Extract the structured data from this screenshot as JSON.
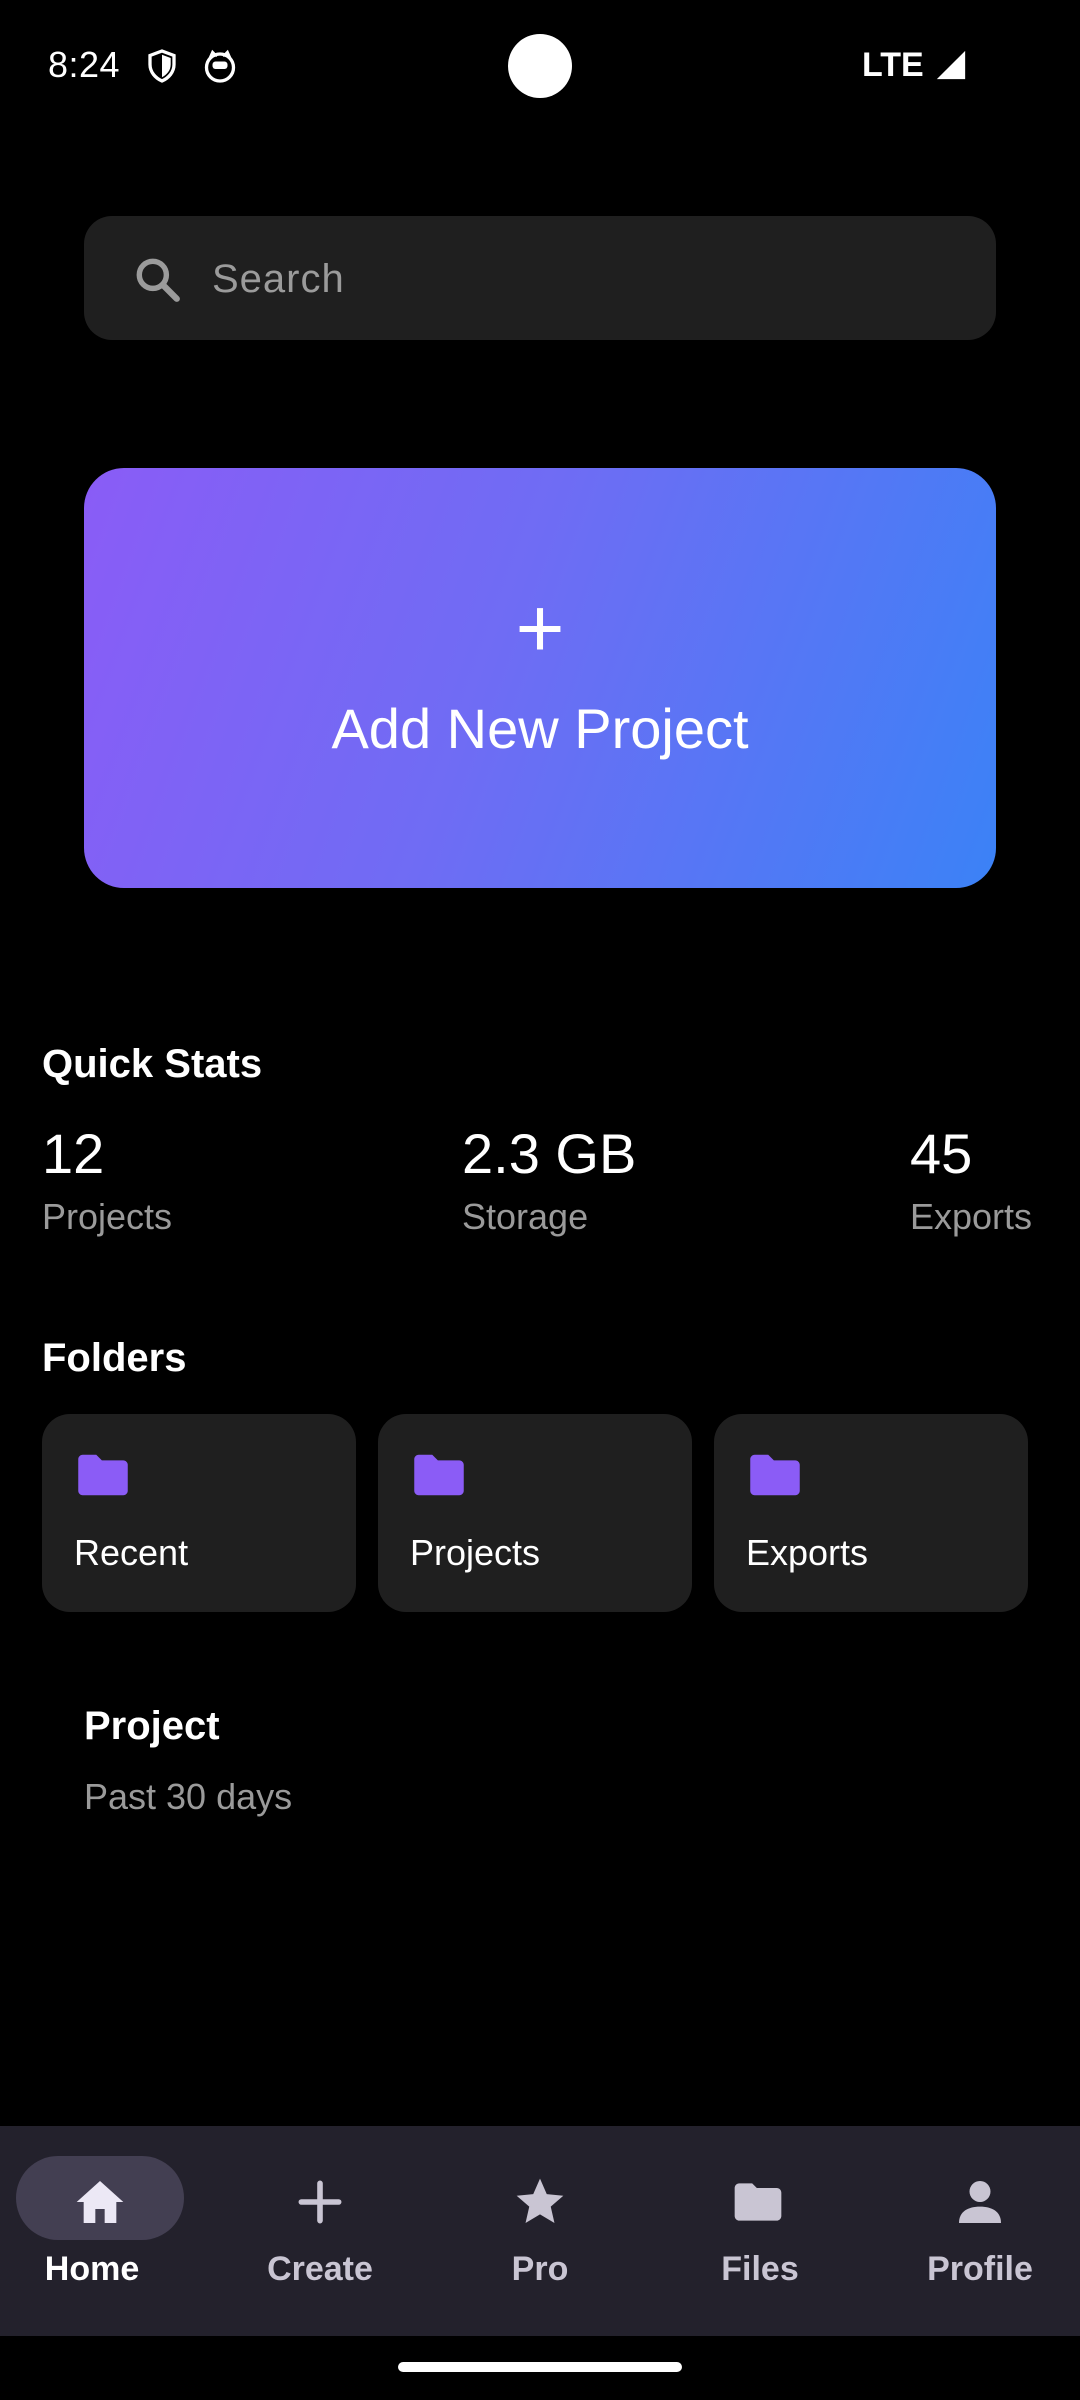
{
  "status_bar": {
    "time": "8:24",
    "network": "LTE",
    "icons": [
      "shield-icon",
      "cat-face-icon",
      "signal-icon"
    ]
  },
  "search": {
    "placeholder": "Search",
    "value": ""
  },
  "add_project": {
    "plus": "+",
    "label": "Add New Project",
    "gradient_colors": [
      "#8a5cf6",
      "#3b82f6"
    ]
  },
  "quick_stats": {
    "title": "Quick Stats",
    "items": [
      {
        "value": "12",
        "label": "Projects"
      },
      {
        "value": "2.3 GB",
        "label": "Storage"
      },
      {
        "value": "45",
        "label": "Exports"
      }
    ]
  },
  "folders": {
    "title": "Folders",
    "items": [
      {
        "label": "Recent",
        "icon": "folder-icon"
      },
      {
        "label": "Projects",
        "icon": "folder-icon"
      },
      {
        "label": "Exports",
        "icon": "folder-icon"
      }
    ],
    "accent": "#8b5cf6"
  },
  "project": {
    "title": "Project",
    "subtitle": "Past 30 days"
  },
  "bottom_nav": {
    "active": "Home",
    "items": [
      {
        "label": "Home",
        "icon": "home-icon"
      },
      {
        "label": "Create",
        "icon": "plus-icon"
      },
      {
        "label": "Pro",
        "icon": "star-icon"
      },
      {
        "label": "Files",
        "icon": "folder-icon"
      },
      {
        "label": "Profile",
        "icon": "person-icon"
      }
    ]
  },
  "colors": {
    "background": "#000000",
    "surface": "#1f1f1f",
    "nav_background": "#23212c",
    "nav_active_pill": "#433f52",
    "secondary_text": "#9a9a9a"
  }
}
